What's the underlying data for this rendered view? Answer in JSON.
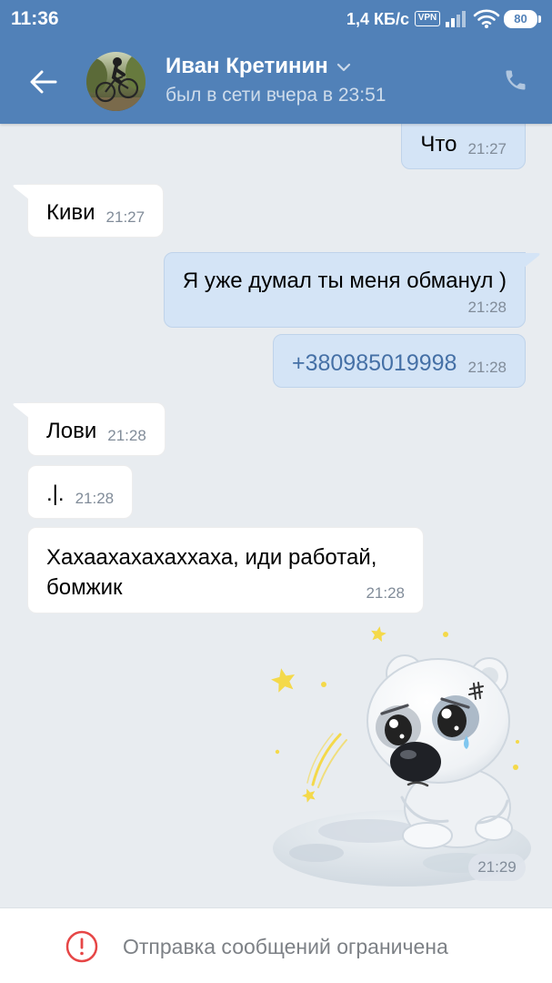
{
  "status_bar": {
    "time": "11:36",
    "network_speed": "1,4 КБ/с",
    "vpn_label": "VPN",
    "battery": "80"
  },
  "header": {
    "contact_name": "Иван Кретинин",
    "status": "был в сети вчера в 23:51",
    "icons": {
      "back": "arrow-left-icon",
      "expand": "chevron-down-icon",
      "call": "phone-icon"
    }
  },
  "messages": [
    {
      "text": "Что",
      "time": "21:27"
    },
    {
      "text": "Киви",
      "time": "21:27"
    },
    {
      "text": "Я уже думал ты меня обманул )",
      "time": "21:28"
    },
    {
      "text": "+380985019998",
      "time": "21:28"
    },
    {
      "text": "Лови",
      "time": "21:28"
    },
    {
      "text": ".|.",
      "time": "21:28"
    },
    {
      "text": "Хахаахахахаххаха, иди работай, бомжик",
      "time": "21:28"
    }
  ],
  "sticker": {
    "time": "21:29",
    "icon": "sad-bear-on-moon-sticker"
  },
  "footer": {
    "notice": "Отправка сообщений ограничена",
    "icon": "exclamation-circle-icon"
  },
  "colors": {
    "header_bg": "#5181b8",
    "chat_bg": "#e8ecf0",
    "incoming_bubble": "#ffffff",
    "outgoing_bubble": "#d4e4f6",
    "link": "#4570a6",
    "time": "#818c99",
    "warning": "#e64646"
  }
}
